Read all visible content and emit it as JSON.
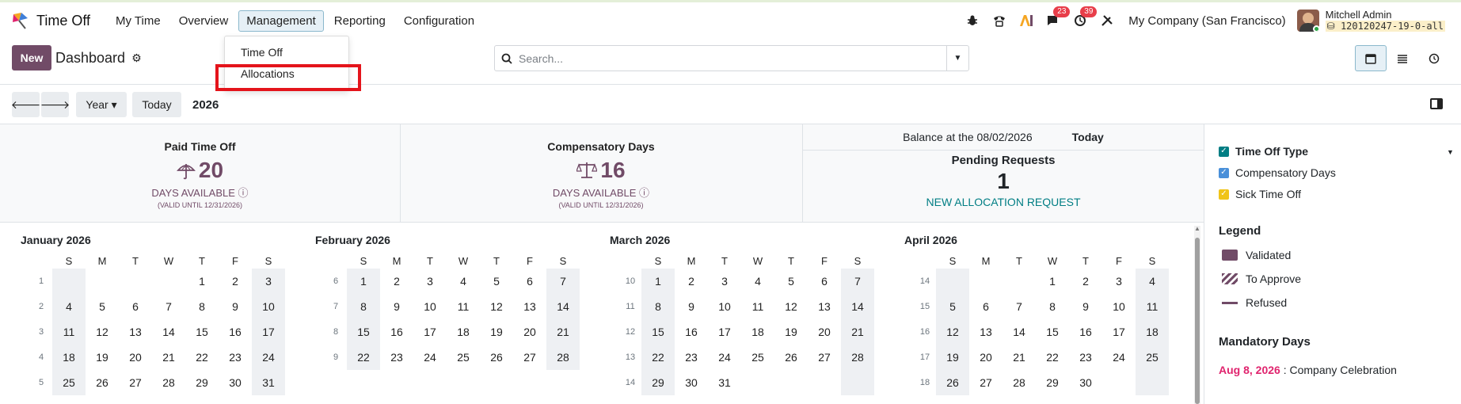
{
  "navbar": {
    "app_name": "Time Off",
    "menu": [
      "My Time",
      "Overview",
      "Management",
      "Reporting",
      "Configuration"
    ],
    "active_menu": "Management",
    "messages_count": "23",
    "activities_count": "39",
    "company": "My Company (San Francisco)",
    "user_name": "Mitchell Admin",
    "database": "120120247-19-0-all"
  },
  "control_panel": {
    "new_label": "New",
    "breadcrumb": "Dashboard",
    "search_placeholder": "Search...",
    "views": [
      "calendar-icon",
      "list-icon",
      "activity-icon"
    ],
    "active_view": "calendar"
  },
  "dropdown": {
    "items": [
      "Time Off",
      "Allocations"
    ],
    "highlighted": "Allocations"
  },
  "calendar_nav": {
    "scale": "Year",
    "today_label": "Today",
    "year": "2026"
  },
  "stats": {
    "cards": [
      {
        "title": "Paid Time Off",
        "value": "20",
        "label": "DAYS AVAILABLE",
        "valid": "(VALID UNTIL 12/31/2026)"
      },
      {
        "title": "Compensatory Days",
        "value": "16",
        "label": "DAYS AVAILABLE",
        "valid": "(VALID UNTIL 12/31/2026)"
      }
    ],
    "balance_label": "Balance at the 08/02/2026",
    "balance_today": "Today",
    "pending_title": "Pending Requests",
    "pending_count": "1",
    "new_allocation": "NEW ALLOCATION REQUEST"
  },
  "side_panel": {
    "filter_title": "Time Off Type",
    "filters": [
      {
        "label": "Compensatory Days",
        "color": "#4a90d9"
      },
      {
        "label": "Sick Time Off",
        "color": "#f0c419"
      }
    ],
    "legend_title": "Legend",
    "legend": [
      "Validated",
      "To Approve",
      "Refused"
    ],
    "mandatory_title": "Mandatory Days",
    "mandatory_date": "Aug 8, 2026",
    "mandatory_name": " : Company Celebration"
  },
  "weekday_headers": [
    "S",
    "M",
    "T",
    "W",
    "T",
    "F",
    "S"
  ],
  "months": [
    {
      "title": "January 2026",
      "weeks": [
        {
          "wk": "1",
          "days": [
            "",
            "",
            "",
            "",
            "1",
            "2",
            "3"
          ]
        },
        {
          "wk": "2",
          "days": [
            "4",
            "5",
            "6",
            "7",
            "8",
            "9",
            "10"
          ]
        },
        {
          "wk": "3",
          "days": [
            "11",
            "12",
            "13",
            "14",
            "15",
            "16",
            "17"
          ]
        },
        {
          "wk": "4",
          "days": [
            "18",
            "19",
            "20",
            "21",
            "22",
            "23",
            "24"
          ]
        },
        {
          "wk": "5",
          "days": [
            "25",
            "26",
            "27",
            "28",
            "29",
            "30",
            "31"
          ]
        }
      ]
    },
    {
      "title": "February 2026",
      "weeks": [
        {
          "wk": "6",
          "days": [
            "1",
            "2",
            "3",
            "4",
            "5",
            "6",
            "7"
          ]
        },
        {
          "wk": "7",
          "days": [
            "8",
            "9",
            "10",
            "11",
            "12",
            "13",
            "14"
          ]
        },
        {
          "wk": "8",
          "days": [
            "15",
            "16",
            "17",
            "18",
            "19",
            "20",
            "21"
          ]
        },
        {
          "wk": "9",
          "days": [
            "22",
            "23",
            "24",
            "25",
            "26",
            "27",
            "28"
          ]
        }
      ]
    },
    {
      "title": "March 2026",
      "weeks": [
        {
          "wk": "10",
          "days": [
            "1",
            "2",
            "3",
            "4",
            "5",
            "6",
            "7"
          ]
        },
        {
          "wk": "11",
          "days": [
            "8",
            "9",
            "10",
            "11",
            "12",
            "13",
            "14"
          ]
        },
        {
          "wk": "12",
          "days": [
            "15",
            "16",
            "17",
            "18",
            "19",
            "20",
            "21"
          ]
        },
        {
          "wk": "13",
          "days": [
            "22",
            "23",
            "24",
            "25",
            "26",
            "27",
            "28"
          ]
        },
        {
          "wk": "14",
          "days": [
            "29",
            "30",
            "31",
            "",
            "",
            "",
            ""
          ]
        }
      ]
    },
    {
      "title": "April 2026",
      "weeks": [
        {
          "wk": "14",
          "days": [
            "",
            "",
            "",
            "1",
            "2",
            "3",
            "4"
          ]
        },
        {
          "wk": "15",
          "days": [
            "5",
            "6",
            "7",
            "8",
            "9",
            "10",
            "11"
          ]
        },
        {
          "wk": "16",
          "days": [
            "12",
            "13",
            "14",
            "15",
            "16",
            "17",
            "18"
          ]
        },
        {
          "wk": "17",
          "days": [
            "19",
            "20",
            "21",
            "22",
            "23",
            "24",
            "25"
          ]
        },
        {
          "wk": "18",
          "days": [
            "26",
            "27",
            "28",
            "29",
            "30",
            "",
            ""
          ]
        }
      ]
    }
  ],
  "colors": {
    "brand": "#714b67",
    "link": "#017e84",
    "highlight": "#e4141b",
    "mandatory": "#e0246e"
  }
}
